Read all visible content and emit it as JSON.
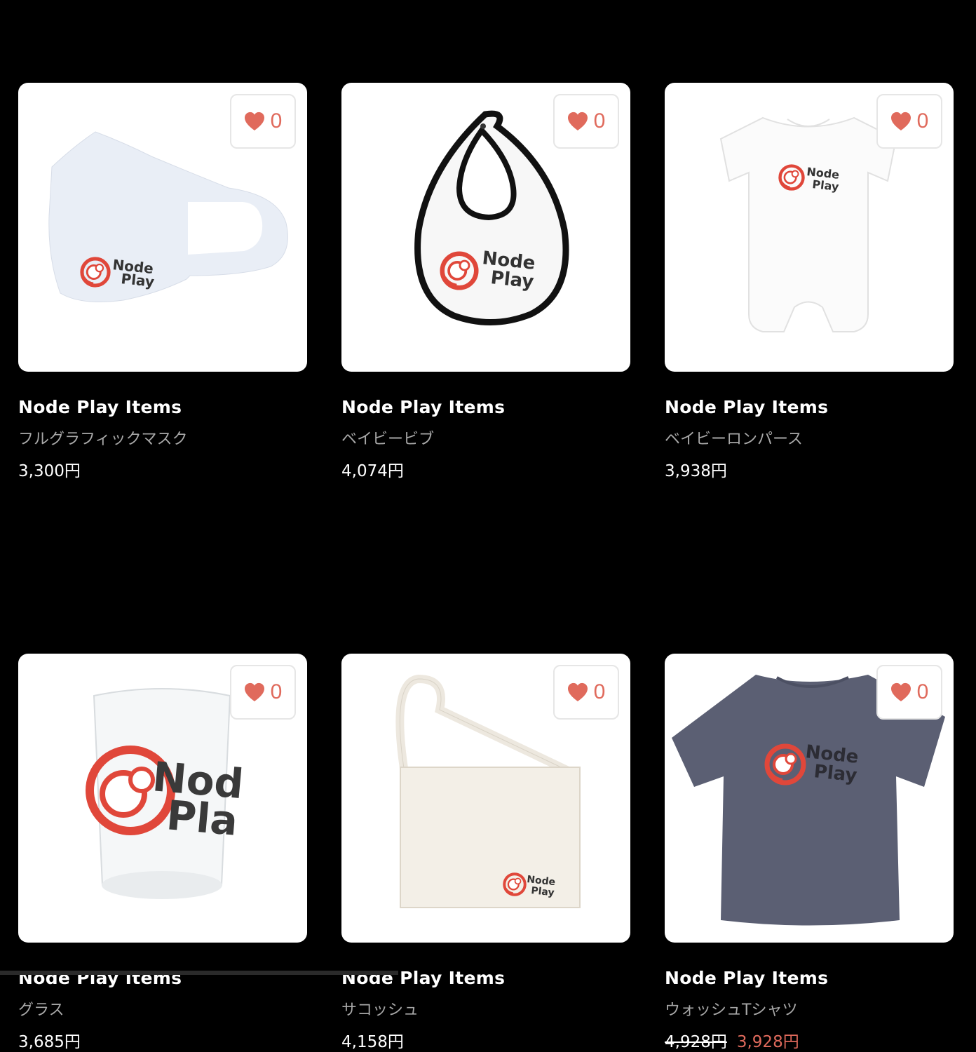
{
  "colors": {
    "background": "#000000",
    "card": "#ffffff",
    "heart": "#e06a5c",
    "sale_price": "#e06a5c",
    "product_name": "#a8a8a8"
  },
  "items": [
    {
      "shop": "Node Play Items",
      "name": "フルグラフィックマスク",
      "price": "3,300円",
      "likes": "0",
      "icon": "heart-icon",
      "product_type": "mask",
      "logo_text": [
        "Node",
        "Play"
      ]
    },
    {
      "shop": "Node Play Items",
      "name": "ベイビービブ",
      "price": "4,074円",
      "likes": "0",
      "icon": "heart-icon",
      "product_type": "bib",
      "logo_text": [
        "Node",
        "Play"
      ]
    },
    {
      "shop": "Node Play Items",
      "name": "ベイビーロンパース",
      "price": "3,938円",
      "likes": "0",
      "icon": "heart-icon",
      "product_type": "romper",
      "logo_text": [
        "Node",
        "Play"
      ]
    },
    {
      "shop": "Node Play Items",
      "name": "グラス",
      "price": "3,685円",
      "likes": "0",
      "icon": "heart-icon",
      "product_type": "glass",
      "logo_text": [
        "Node",
        "Play"
      ]
    },
    {
      "shop": "Node Play Items",
      "name": "サコッシュ",
      "price": "4,158円",
      "likes": "0",
      "icon": "heart-icon",
      "product_type": "sacoche",
      "logo_text": [
        "Node",
        "Play"
      ]
    },
    {
      "shop": "Node Play Items",
      "name": "ウォッシュTシャツ",
      "price": "",
      "original_price": "4,928円",
      "sale_price": "3,928円",
      "likes": "0",
      "icon": "heart-icon",
      "product_type": "tshirt",
      "logo_text": [
        "Node",
        "Play"
      ]
    }
  ]
}
